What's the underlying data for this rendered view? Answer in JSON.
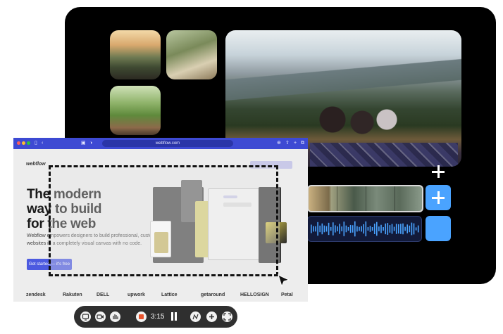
{
  "browser": {
    "url": "webflow.com",
    "logo": "webflow",
    "hero": {
      "line1": "The modern",
      "line2": "way to build",
      "line3": "for the web"
    },
    "description": "Webflow empowers designers to build professional, custom websites in a completely visual canvas with no code.",
    "cta_label": "Get started — it's free",
    "logos": [
      "zendesk",
      "Rakuten",
      "DELL",
      "upwork",
      "Lattice",
      "getaround",
      "HELLOSIGN",
      "Petal"
    ]
  },
  "recorder": {
    "time": "3:15"
  },
  "colors": {
    "editor_bg": "#000000",
    "accent_blue": "#4aa3ff",
    "browser_bar": "#3d4ad3",
    "stop_red": "#e8542e"
  },
  "icons": [
    "window-icon",
    "camera-icon",
    "hand-icon",
    "stop-icon",
    "pause-icon",
    "draw-icon",
    "plus-icon",
    "fullscreen-icon",
    "plus-icon",
    "cursor-icon"
  ]
}
